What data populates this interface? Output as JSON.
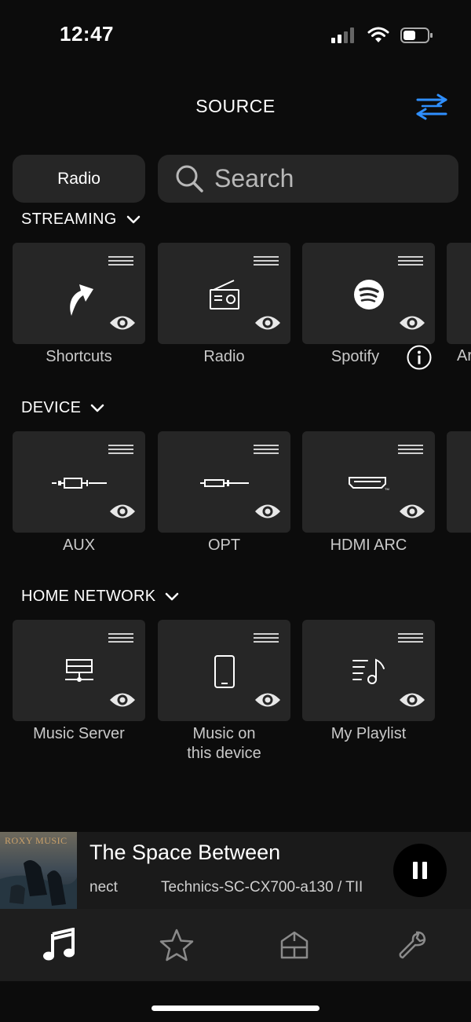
{
  "status_bar": {
    "time": "12:47"
  },
  "header": {
    "title": "SOURCE",
    "accent": "#2f8fff"
  },
  "controls": {
    "radio_chip": "Radio",
    "search_placeholder": "Search"
  },
  "sections": {
    "streaming": {
      "title": "STREAMING",
      "tiles": [
        {
          "label": "Shortcuts",
          "icon": "shortcut-arrow-icon"
        },
        {
          "label": "Radio",
          "icon": "radio-icon"
        },
        {
          "label": "Spotify",
          "icon": "spotify-icon"
        },
        {
          "label": "Ar",
          "icon": "unknown"
        }
      ]
    },
    "device": {
      "title": "DEVICE",
      "tiles": [
        {
          "label": "AUX",
          "icon": "aux-cable-icon"
        },
        {
          "label": "OPT",
          "icon": "optical-cable-icon"
        },
        {
          "label": "HDMI ARC",
          "icon": "hdmi-icon"
        }
      ]
    },
    "home_network": {
      "title": "HOME NETWORK",
      "tiles": [
        {
          "label": "Music Server",
          "icon": "music-server-icon"
        },
        {
          "label_line1": "Music on",
          "label_line2": "this device",
          "icon": "phone-icon"
        },
        {
          "label": "My Playlist",
          "icon": "playlist-icon"
        }
      ]
    }
  },
  "now_playing": {
    "album_text": "ROXY MUSIC",
    "title": "The Space Between",
    "source": "nect",
    "device": "Technics-SC-CX700-a130 / TII"
  },
  "tabs": [
    "music-note-icon",
    "star-icon",
    "home-icon",
    "wrench-icon"
  ]
}
